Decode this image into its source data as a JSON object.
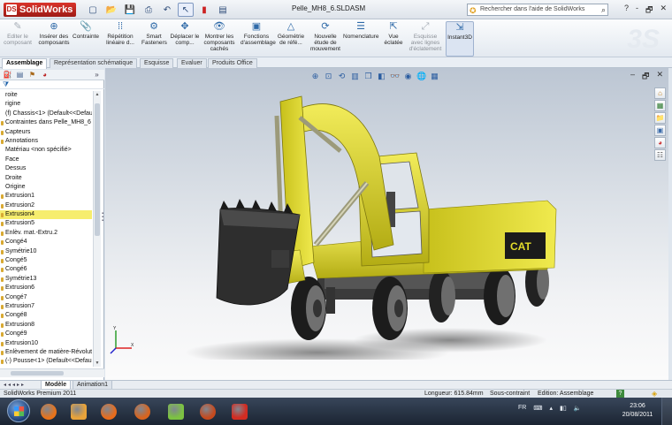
{
  "titlebar": {
    "app_name": "SolidWorks",
    "document": "Pelle_MH8_6.SLDASM",
    "search_placeholder": "Rechercher dans l'aide de SolidWorks",
    "window_controls": [
      "?",
      "-",
      "🗗",
      "✕"
    ]
  },
  "ribbon": {
    "items": [
      {
        "label": "Editer le composant",
        "icon": "edit-component-icon",
        "glyph": "✎",
        "enabled": false
      },
      {
        "label": "Insérer des composants",
        "icon": "insert-components-icon",
        "glyph": "⊕",
        "enabled": true
      },
      {
        "label": "Contrainte",
        "icon": "mate-icon",
        "glyph": "📎",
        "enabled": true
      },
      {
        "label": "Répétition linéaire d...",
        "icon": "linear-pattern-icon",
        "glyph": "⁞⁞",
        "enabled": true
      },
      {
        "label": "Smart Fasteners",
        "icon": "smart-fasteners-icon",
        "glyph": "⚙",
        "enabled": true
      },
      {
        "label": "Déplacer le comp...",
        "icon": "move-component-icon",
        "glyph": "✥",
        "enabled": true
      },
      {
        "label": "Montrer les composants cachés",
        "icon": "show-hidden-icon",
        "glyph": "👁",
        "enabled": true
      },
      {
        "label": "Fonctions d'assemblage",
        "icon": "assembly-features-icon",
        "glyph": "▣",
        "enabled": true
      },
      {
        "label": "Géométrie de réfé...",
        "icon": "reference-geometry-icon",
        "glyph": "△",
        "enabled": true
      },
      {
        "label": "Nouvelle étude de mouvement",
        "icon": "motion-study-icon",
        "glyph": "⟳",
        "enabled": true
      },
      {
        "label": "Nomenclature",
        "icon": "bom-icon",
        "glyph": "☰",
        "enabled": true
      },
      {
        "label": "Vue éclatée",
        "icon": "exploded-view-icon",
        "glyph": "⇱",
        "enabled": true
      },
      {
        "label": "Esquisse avec lignes d'éclatement",
        "icon": "explode-line-sketch-icon",
        "glyph": "⤢",
        "enabled": false
      },
      {
        "label": "Instant3D",
        "icon": "instant3d-icon",
        "glyph": "⇲",
        "enabled": true,
        "active": true
      }
    ]
  },
  "tabs": [
    {
      "label": "Assemblage",
      "active": true
    },
    {
      "label": "Représentation schématique",
      "active": false
    },
    {
      "label": "Esquisse",
      "active": false
    },
    {
      "label": "Evaluer",
      "active": false
    },
    {
      "label": "Produits Office",
      "active": false
    }
  ],
  "tree": {
    "items": [
      {
        "label": "roite",
        "folder": false
      },
      {
        "label": "rigine",
        "folder": false
      },
      {
        "label": "(f) Chassis<1> (Default<<Defaul",
        "folder": false
      },
      {
        "label": "Contraintes dans Pelle_MH8_6",
        "folder": true
      },
      {
        "label": "Capteurs",
        "folder": true
      },
      {
        "label": "Annotations",
        "folder": true
      },
      {
        "label": "Matériau <non spécifié>",
        "folder": false
      },
      {
        "label": "Face",
        "folder": false
      },
      {
        "label": "Dessus",
        "folder": false
      },
      {
        "label": "Droite",
        "folder": false
      },
      {
        "label": "Origine",
        "folder": false
      },
      {
        "label": "Extrusion1",
        "folder": true
      },
      {
        "label": "Extrusion2",
        "folder": true
      },
      {
        "label": "Extrusion4",
        "folder": true,
        "selected": true
      },
      {
        "label": "Extrusion5",
        "folder": true
      },
      {
        "label": "Enlèv. mat.-Extru.2",
        "folder": true
      },
      {
        "label": "Congé4",
        "folder": true
      },
      {
        "label": "Symétrie10",
        "folder": true
      },
      {
        "label": "Congé5",
        "folder": true
      },
      {
        "label": "Congé6",
        "folder": true
      },
      {
        "label": "Symétrie13",
        "folder": true
      },
      {
        "label": "Extrusion6",
        "folder": true
      },
      {
        "label": "Congé7",
        "folder": true
      },
      {
        "label": "Extrusion7",
        "folder": true
      },
      {
        "label": "Congé8",
        "folder": true
      },
      {
        "label": "Extrusion8",
        "folder": true
      },
      {
        "label": "Congé9",
        "folder": true
      },
      {
        "label": "Extrusion10",
        "folder": true
      },
      {
        "label": "Enlèvement de matière-Révolut",
        "folder": true
      },
      {
        "label": "(-) Pousse<1> (Default<<Defaul",
        "folder": true
      }
    ]
  },
  "bottom_tabs": [
    {
      "label": "Modèle",
      "active": true
    },
    {
      "label": "Animation1",
      "active": false
    }
  ],
  "status": {
    "product": "SolidWorks Premium 2011",
    "length": "Longueur: 615.84mm",
    "constraint": "Sous-contraint",
    "mode": "Edition: Assemblage",
    "help": "?"
  },
  "taskbar": {
    "apps": [
      {
        "name": "firefox-icon",
        "color": "#e8731a"
      },
      {
        "name": "folder-icon",
        "color": "#e8a33a"
      },
      {
        "name": "media-player-icon",
        "color": "#e86c1c"
      },
      {
        "name": "firefox-icon-2",
        "color": "#d8641e"
      },
      {
        "name": "messenger-icon",
        "color": "#7cc242"
      },
      {
        "name": "app-orb-icon",
        "color": "#c64a1e"
      },
      {
        "name": "solidworks-icon",
        "color": "#d22c22"
      }
    ],
    "lang": "FR",
    "time": "23:06",
    "date": "20/08/2011"
  },
  "colors": {
    "excavator_yellow": "#e3dc2a",
    "accent_blue": "#2f6aa8"
  }
}
